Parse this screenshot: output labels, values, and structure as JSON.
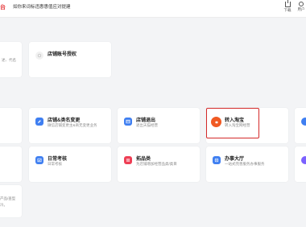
{
  "topbar": {
    "brand": "台",
    "notice": "如你来词标违惠惠值应对提建",
    "download_label": "下载",
    "user_label": "用户"
  },
  "cards": {
    "shop_account": {
      "title": "店铺账号授权"
    },
    "shop_change": {
      "title": "店铺&类名变更",
      "desc": "微信店铺变更主&商无变更业务"
    },
    "shop_exit": {
      "title": "店铺退出",
      "desc": "退出天猫经营"
    },
    "transfer_taobao": {
      "title": "转入淘宝",
      "desc": "转入淘宝网经营"
    },
    "daily_exam": {
      "title": "日常考核",
      "desc": "日常考核"
    },
    "expand_category": {
      "title": "拓品类",
      "desc": "为店铺增加经营品类/类目"
    },
    "service_hall": {
      "title": "办事大厅",
      "desc": "一站式完善服务办事服务"
    },
    "left_fragments": {
      "line1": "述、代名",
      "line2": "产品/查型",
      "line3": "冷。"
    }
  },
  "colors": {
    "accent_red": "#e4393c",
    "blue": "#3f7ff1",
    "orange_red": "#f05a23",
    "pink_red": "#ee3f55",
    "highlight": "#d42a2a"
  }
}
